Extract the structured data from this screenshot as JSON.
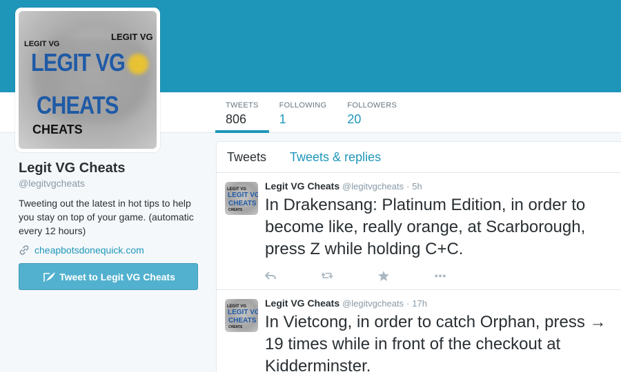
{
  "colors": {
    "brand": "#1e96b9",
    "button": "#52b1cf",
    "background": "#f5f8fa",
    "muted": "#8899a6"
  },
  "avatar": {
    "logo_text_main": "LEGIT VG",
    "logo_text_main_2": "CHEATS",
    "logo_text_small": "LEGIT VG",
    "logo_text_small_2": "CHEATS"
  },
  "stats": [
    {
      "label": "TWEETS",
      "value": "806"
    },
    {
      "label": "FOLLOWING",
      "value": "1"
    },
    {
      "label": "FOLLOWERS",
      "value": "20"
    }
  ],
  "profile": {
    "name": "Legit VG Cheats",
    "handle": "@legitvgcheats",
    "bio": "Tweeting out the latest in hot tips to help you stay on top of your game. (automatic every 12 hours)",
    "link": "cheapbotsdonequick.com",
    "link_icon": "link-icon"
  },
  "tweet_to_button": {
    "label": "Tweet to Legit VG Cheats",
    "icon": "quill-icon"
  },
  "tabs": [
    {
      "label": "Tweets"
    },
    {
      "label": "Tweets & replies"
    }
  ],
  "tweets": [
    {
      "author": "Legit VG Cheats",
      "handle": "@legitvgcheats",
      "dot": "·",
      "time": "5h",
      "text": "In Drakensang: Platinum Edition, in order to become like, really orange, at Scarborough, press Z while holding C+C."
    },
    {
      "author": "Legit VG Cheats",
      "handle": "@legitvgcheats",
      "dot": "·",
      "time": "17h",
      "text": "In Vietcong, in order to catch Orphan, press → 19 times while in front of the checkout at Kidderminster."
    }
  ],
  "tweet_actions": [
    "reply-icon",
    "retweet-icon",
    "favorite-icon",
    "more-icon"
  ]
}
